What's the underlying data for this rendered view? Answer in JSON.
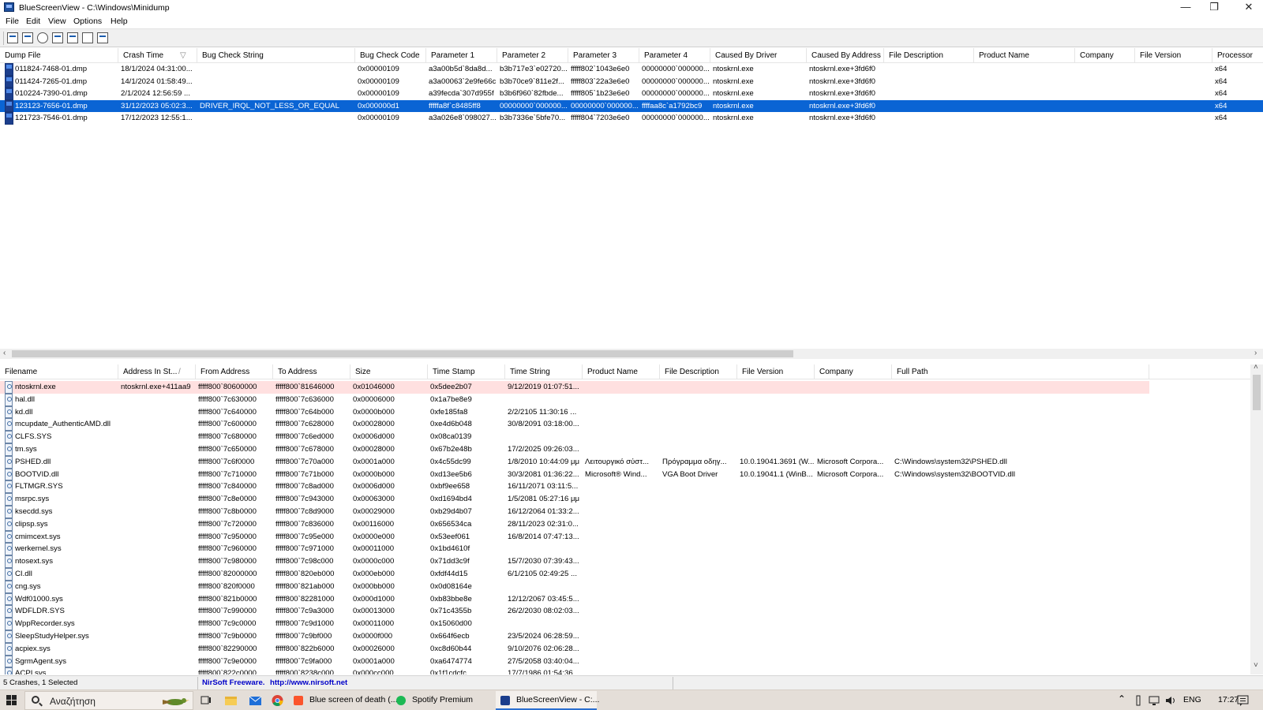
{
  "window": {
    "title": "BlueScreenView  -  C:\\Windows\\Minidump",
    "minimize": "—",
    "maximize": "❐",
    "close": "✕"
  },
  "menu": [
    "File",
    "Edit",
    "View",
    "Options",
    "Help"
  ],
  "toolbar_icons": [
    "html-report-icon",
    "save-icon",
    "refresh-icon",
    "copy-icon",
    "properties-icon",
    "find-icon",
    "exit-icon"
  ],
  "top_table": {
    "columns": [
      "Dump File",
      "Crash Time",
      "Bug Check String",
      "Bug Check Code",
      "Parameter 1",
      "Parameter 2",
      "Parameter 3",
      "Parameter 4",
      "Caused By Driver",
      "Caused By Address",
      "File Description",
      "Product Name",
      "Company",
      "File Version",
      "Processor"
    ],
    "sort_indicator": "▽",
    "rows": [
      [
        "011824-7468-01.dmp",
        "18/1/2024 04:31:00...",
        "",
        "0x00000109",
        "a3a00b5d`8da8d...",
        "b3b717e3`e02720...",
        "fffff802`1043e6e0",
        "00000000`000000...",
        "ntoskrnl.exe",
        "ntoskrnl.exe+3fd6f0",
        "",
        "",
        "",
        "",
        "x64"
      ],
      [
        "011424-7265-01.dmp",
        "14/1/2024 01:58:49...",
        "",
        "0x00000109",
        "a3a00063`2e9fe66c",
        "b3b70ce9`811e2f...",
        "fffff803`22a3e6e0",
        "00000000`000000...",
        "ntoskrnl.exe",
        "ntoskrnl.exe+3fd6f0",
        "",
        "",
        "",
        "",
        "x64"
      ],
      [
        "010224-7390-01.dmp",
        "2/1/2024 12:56:59 ...",
        "",
        "0x00000109",
        "a39fecda`307d955f",
        "b3b6f960`82fbde...",
        "fffff805`1b23e6e0",
        "00000000`000000...",
        "ntoskrnl.exe",
        "ntoskrnl.exe+3fd6f0",
        "",
        "",
        "",
        "",
        "x64"
      ],
      [
        "123123-7656-01.dmp",
        "31/12/2023 05:02:3...",
        "DRIVER_IRQL_NOT_LESS_OR_EQUAL",
        "0x000000d1",
        "fffffa8f`c8485ff8",
        "00000000`000000...",
        "00000000`000000...",
        "ffffaa8c`a1792bc9",
        "ntoskrnl.exe",
        "ntoskrnl.exe+3fd6f0",
        "",
        "",
        "",
        "",
        "x64"
      ],
      [
        "121723-7546-01.dmp",
        "17/12/2023 12:55:1...",
        "",
        "0x00000109",
        "a3a026e8`098027...",
        "b3b7336e`5bfe70...",
        "fffff804`7203e6e0",
        "00000000`000000...",
        "ntoskrnl.exe",
        "ntoskrnl.exe+3fd6f0",
        "",
        "",
        "",
        "",
        "x64"
      ]
    ],
    "selected_index": 3
  },
  "bottom_table": {
    "columns": [
      "Filename",
      "Address In St...",
      "From Address",
      "To Address",
      "Size",
      "Time Stamp",
      "Time String",
      "Product Name",
      "File Description",
      "File Version",
      "Company",
      "Full Path"
    ],
    "sort_indicator": "/",
    "rows": [
      [
        "ntoskrnl.exe",
        "ntoskrnl.exe+411aa9",
        "fffff800`80600000",
        "fffff800`81646000",
        "0x01046000",
        "0x5dee2b07",
        "9/12/2019 01:07:51...",
        "",
        "",
        "",
        "",
        ""
      ],
      [
        "hal.dll",
        "",
        "fffff800`7c630000",
        "fffff800`7c636000",
        "0x00006000",
        "0x1a7be8e9",
        "",
        "",
        "",
        "",
        "",
        ""
      ],
      [
        "kd.dll",
        "",
        "fffff800`7c640000",
        "fffff800`7c64b000",
        "0x0000b000",
        "0xfe185fa8",
        "2/2/2105 11:30:16 ...",
        "",
        "",
        "",
        "",
        ""
      ],
      [
        "mcupdate_AuthenticAMD.dll",
        "",
        "fffff800`7c600000",
        "fffff800`7c628000",
        "0x00028000",
        "0xe4d6b048",
        "30/8/2091 03:18:00...",
        "",
        "",
        "",
        "",
        ""
      ],
      [
        "CLFS.SYS",
        "",
        "fffff800`7c680000",
        "fffff800`7c6ed000",
        "0x0006d000",
        "0x08ca0139",
        "",
        "",
        "",
        "",
        "",
        ""
      ],
      [
        "tm.sys",
        "",
        "fffff800`7c650000",
        "fffff800`7c678000",
        "0x00028000",
        "0x67b2e48b",
        "17/2/2025 09:26:03...",
        "",
        "",
        "",
        "",
        ""
      ],
      [
        "PSHED.dll",
        "",
        "fffff800`7c6f0000",
        "fffff800`7c70a000",
        "0x0001a000",
        "0x4c55dc99",
        "1/8/2010 10:44:09 μμ",
        "Λειτουργικό σύστ...",
        "Πρόγραμμα οδηγ...",
        "10.0.19041.3691 (W...",
        "Microsoft Corpora...",
        "C:\\Windows\\system32\\PSHED.dll"
      ],
      [
        "BOOTVID.dll",
        "",
        "fffff800`7c710000",
        "fffff800`7c71b000",
        "0x0000b000",
        "0xd13ee5b6",
        "30/3/2081 01:36:22...",
        "Microsoft® Wind...",
        "VGA Boot Driver",
        "10.0.19041.1 (WinB...",
        "Microsoft Corpora...",
        "C:\\Windows\\system32\\BOOTVID.dll"
      ],
      [
        "FLTMGR.SYS",
        "",
        "fffff800`7c840000",
        "fffff800`7c8ad000",
        "0x0006d000",
        "0xbf9ee658",
        "16/11/2071 03:11:5...",
        "",
        "",
        "",
        "",
        ""
      ],
      [
        "msrpc.sys",
        "",
        "fffff800`7c8e0000",
        "fffff800`7c943000",
        "0x00063000",
        "0xd1694bd4",
        "1/5/2081 05:27:16 μμ",
        "",
        "",
        "",
        "",
        ""
      ],
      [
        "ksecdd.sys",
        "",
        "fffff800`7c8b0000",
        "fffff800`7c8d9000",
        "0x00029000",
        "0xb29d4b07",
        "16/12/2064 01:33:2...",
        "",
        "",
        "",
        "",
        ""
      ],
      [
        "clipsp.sys",
        "",
        "fffff800`7c720000",
        "fffff800`7c836000",
        "0x00116000",
        "0x656534ca",
        "28/11/2023 02:31:0...",
        "",
        "",
        "",
        "",
        ""
      ],
      [
        "cmimcext.sys",
        "",
        "fffff800`7c950000",
        "fffff800`7c95e000",
        "0x0000e000",
        "0x53eef061",
        "16/8/2014 07:47:13...",
        "",
        "",
        "",
        "",
        ""
      ],
      [
        "werkernel.sys",
        "",
        "fffff800`7c960000",
        "fffff800`7c971000",
        "0x00011000",
        "0x1bd4610f",
        "",
        "",
        "",
        "",
        "",
        ""
      ],
      [
        "ntosext.sys",
        "",
        "fffff800`7c980000",
        "fffff800`7c98c000",
        "0x0000c000",
        "0x71dd3c9f",
        "15/7/2030 07:39:43...",
        "",
        "",
        "",
        "",
        ""
      ],
      [
        "CI.dll",
        "",
        "fffff800`82000000",
        "fffff800`820eb000",
        "0x000eb000",
        "0xfdf44d15",
        "6/1/2105 02:49:25 ...",
        "",
        "",
        "",
        "",
        ""
      ],
      [
        "cng.sys",
        "",
        "fffff800`820f0000",
        "fffff800`821ab000",
        "0x000bb000",
        "0x0d08164e",
        "",
        "",
        "",
        "",
        "",
        ""
      ],
      [
        "Wdf01000.sys",
        "",
        "fffff800`821b0000",
        "fffff800`82281000",
        "0x000d1000",
        "0xb83bbe8e",
        "12/12/2067 03:45:5...",
        "",
        "",
        "",
        "",
        ""
      ],
      [
        "WDFLDR.SYS",
        "",
        "fffff800`7c990000",
        "fffff800`7c9a3000",
        "0x00013000",
        "0x71c4355b",
        "26/2/2030 08:02:03...",
        "",
        "",
        "",
        "",
        ""
      ],
      [
        "WppRecorder.sys",
        "",
        "fffff800`7c9c0000",
        "fffff800`7c9d1000",
        "0x00011000",
        "0x15060d00",
        "",
        "",
        "",
        "",
        "",
        ""
      ],
      [
        "SleepStudyHelper.sys",
        "",
        "fffff800`7c9b0000",
        "fffff800`7c9bf000",
        "0x0000f000",
        "0x664f6ecb",
        "23/5/2024 06:28:59...",
        "",
        "",
        "",
        "",
        ""
      ],
      [
        "acpiex.sys",
        "",
        "fffff800`82290000",
        "fffff800`822b6000",
        "0x00026000",
        "0xc8d60b44",
        "9/10/2076 02:06:28...",
        "",
        "",
        "",
        "",
        ""
      ],
      [
        "SgrmAgent.sys",
        "",
        "fffff800`7c9e0000",
        "fffff800`7c9fa000",
        "0x0001a000",
        "0xa6474774",
        "27/5/2058 03:40:04...",
        "",
        "",
        "",
        "",
        ""
      ],
      [
        "ACPI.sys",
        "",
        "fffff800`822c0000",
        "fffff800`8238c000",
        "0x000cc000",
        "0x1f1cdcfc",
        "17/7/1986 01:54:36...",
        "",
        "",
        "",
        "",
        ""
      ]
    ],
    "highlight_index": 0
  },
  "status": {
    "summary": "5 Crashes, 1 Selected",
    "freeware": "NirSoft Freeware.",
    "url": "http://www.nirsoft.net",
    "link_color": "#0000c8"
  },
  "taskbar": {
    "search_placeholder": "Αναζήτηση",
    "tasks": [
      "Blue screen of death (...",
      "Spotify Premium",
      "BlueScreenView - C:..."
    ],
    "active_task": 2,
    "language": "ENG",
    "clock": "17:27",
    "chevron": "⌃"
  },
  "colors": {
    "selection": "#0a64d4",
    "pink_row": "#ffe0e0",
    "taskbar": "#e4ded8"
  }
}
